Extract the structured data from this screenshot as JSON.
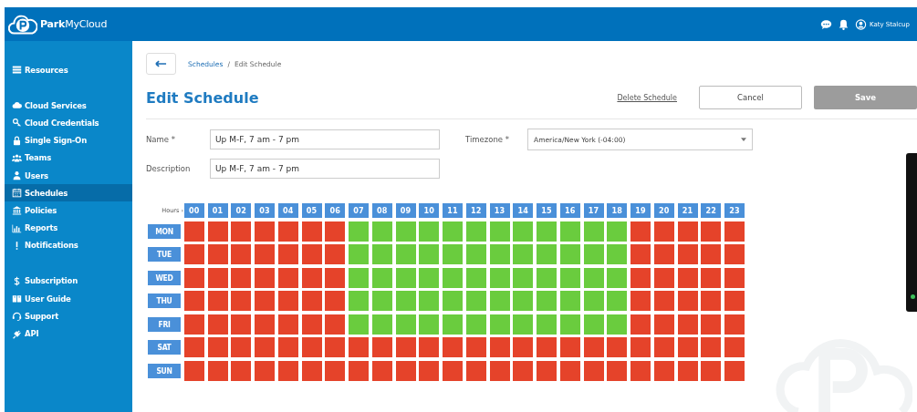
{
  "app": {
    "name_bold": "Park",
    "name_light": "MyCloud"
  },
  "header": {
    "user": "Katy Stalcup"
  },
  "sidebar": {
    "groups": [
      [
        {
          "label": "Resources",
          "selected": false
        }
      ],
      [
        {
          "label": "Cloud Services",
          "selected": false
        },
        {
          "label": "Cloud Credentials",
          "selected": false
        },
        {
          "label": "Single Sign-On",
          "selected": false
        },
        {
          "label": "Teams",
          "selected": false
        },
        {
          "label": "Users",
          "selected": false
        },
        {
          "label": "Schedules",
          "selected": true
        },
        {
          "label": "Policies",
          "selected": false
        },
        {
          "label": "Reports",
          "selected": false
        },
        {
          "label": "Notifications",
          "selected": false
        }
      ],
      [
        {
          "label": "Subscription",
          "selected": false
        },
        {
          "label": "User Guide",
          "selected": false
        },
        {
          "label": "Support",
          "selected": false
        },
        {
          "label": "API",
          "selected": false
        }
      ]
    ]
  },
  "breadcrumb": {
    "link": "Schedules",
    "separator": "/",
    "current": "Edit Schedule"
  },
  "title": "Edit Schedule",
  "actions": {
    "delete": "Delete Schedule",
    "cancel": "Cancel",
    "save": "Save",
    "save_disabled": true
  },
  "form": {
    "name_label": "Name *",
    "name_value": "Up M-F, 7 am - 7 pm",
    "timezone_label": "Timezone *",
    "timezone_value": "America/New York (-04:00)",
    "description_label": "Description",
    "description_value": "Up M-F, 7 am - 7 pm"
  },
  "schedule": {
    "hours_label": "Hours ›",
    "hours": [
      "00",
      "01",
      "02",
      "03",
      "04",
      "05",
      "06",
      "07",
      "08",
      "09",
      "10",
      "11",
      "12",
      "13",
      "14",
      "15",
      "16",
      "17",
      "18",
      "19",
      "20",
      "21",
      "22",
      "23"
    ],
    "days": [
      {
        "label": "MON",
        "up": [
          false,
          false,
          false,
          false,
          false,
          false,
          false,
          true,
          true,
          true,
          true,
          true,
          true,
          true,
          true,
          true,
          true,
          true,
          true,
          false,
          false,
          false,
          false,
          false
        ]
      },
      {
        "label": "TUE",
        "up": [
          false,
          false,
          false,
          false,
          false,
          false,
          false,
          true,
          true,
          true,
          true,
          true,
          true,
          true,
          true,
          true,
          true,
          true,
          true,
          false,
          false,
          false,
          false,
          false
        ]
      },
      {
        "label": "WED",
        "up": [
          false,
          false,
          false,
          false,
          false,
          false,
          false,
          true,
          true,
          true,
          true,
          true,
          true,
          true,
          true,
          true,
          true,
          true,
          true,
          false,
          false,
          false,
          false,
          false
        ]
      },
      {
        "label": "THU",
        "up": [
          false,
          false,
          false,
          false,
          false,
          false,
          false,
          true,
          true,
          true,
          true,
          true,
          true,
          true,
          true,
          true,
          true,
          true,
          true,
          false,
          false,
          false,
          false,
          false
        ]
      },
      {
        "label": "FRI",
        "up": [
          false,
          false,
          false,
          false,
          false,
          false,
          false,
          true,
          true,
          true,
          true,
          true,
          true,
          true,
          true,
          true,
          true,
          true,
          true,
          false,
          false,
          false,
          false,
          false
        ]
      },
      {
        "label": "SAT",
        "up": [
          false,
          false,
          false,
          false,
          false,
          false,
          false,
          false,
          false,
          false,
          false,
          false,
          false,
          false,
          false,
          false,
          false,
          false,
          false,
          false,
          false,
          false,
          false,
          false
        ]
      },
      {
        "label": "SUN",
        "up": [
          false,
          false,
          false,
          false,
          false,
          false,
          false,
          false,
          false,
          false,
          false,
          false,
          false,
          false,
          false,
          false,
          false,
          false,
          false,
          false,
          false,
          false,
          false,
          false
        ]
      }
    ]
  }
}
